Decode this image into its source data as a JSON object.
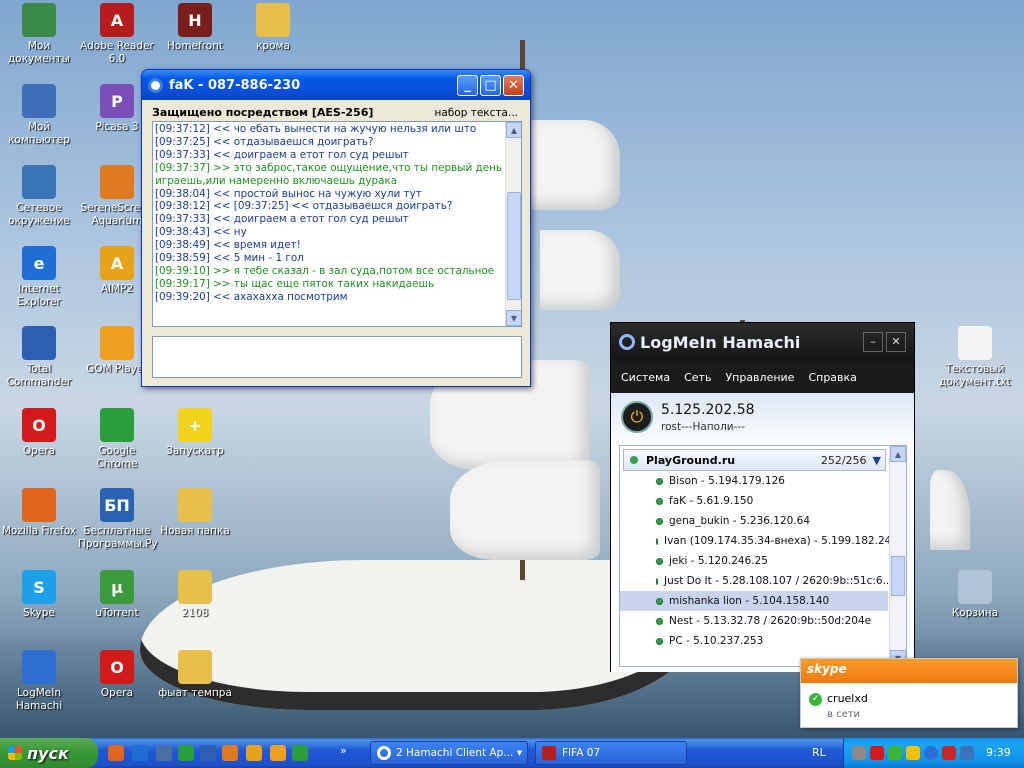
{
  "desktop_icons": [
    {
      "label": "Мои документы",
      "glyph": "",
      "color": "#3b8a4a"
    },
    {
      "label": "Adobe Reader 6.0",
      "glyph": "A",
      "color": "#b71c1c"
    },
    {
      "label": "Homefront",
      "glyph": "H",
      "color": "#7a1d1d"
    },
    {
      "label": "крома",
      "glyph": "",
      "color": "#e6c04a"
    },
    {
      "label": "Мой компьютер",
      "glyph": "",
      "color": "#3d6fb8"
    },
    {
      "label": "Picasa 3",
      "glyph": "P",
      "color": "#7b4fb8"
    },
    {
      "label": "Сетевое окружение",
      "glyph": "",
      "color": "#3a74b6"
    },
    {
      "label": "SereneScreen Aquarium",
      "glyph": "",
      "color": "#e07a1f"
    },
    {
      "label": "Internet Explorer",
      "glyph": "e",
      "color": "#1f6ed4"
    },
    {
      "label": "AIMP2",
      "glyph": "A",
      "color": "#e8a21a"
    },
    {
      "label": "Total Commander",
      "glyph": "",
      "color": "#2d5fb2"
    },
    {
      "label": "GOM Player",
      "glyph": "",
      "color": "#f0a020"
    },
    {
      "label": "Opera",
      "glyph": "O",
      "color": "#d21a1a"
    },
    {
      "label": "Google Chrome",
      "glyph": "",
      "color": "#2a9d3c"
    },
    {
      "label": "Запускатр",
      "glyph": "+",
      "color": "#f2d21a"
    },
    {
      "label": "Mozilla Firefox",
      "glyph": "",
      "color": "#e0661c"
    },
    {
      "label": "Бесплатные Программы.Ру",
      "glyph": "БП",
      "color": "#2962b0"
    },
    {
      "label": "Новая папка",
      "glyph": "",
      "color": "#e6c04a"
    },
    {
      "label": "Skype",
      "glyph": "S",
      "color": "#1ea0e8"
    },
    {
      "label": "uTorrent",
      "glyph": "µ",
      "color": "#3b9a3b"
    },
    {
      "label": "2108",
      "glyph": "",
      "color": "#e6c04a"
    },
    {
      "label": "LogMeIn Hamachi",
      "glyph": "",
      "color": "#2d6fd2"
    },
    {
      "label": "Opera",
      "glyph": "O",
      "color": "#d21a1a"
    },
    {
      "label": "фыат темпра",
      "glyph": "",
      "color": "#e6c04a"
    },
    {
      "label": "Текстовый документ.txt",
      "glyph": "",
      "color": "#f5f5f5"
    },
    {
      "label": "Корзина",
      "glyph": "",
      "color": "#b0c4d8"
    }
  ],
  "chat": {
    "title": "faK - 087-886-230",
    "security_label": "Защищено посредством [AES-256]",
    "typing_label": "набор текста...",
    "input_value": "",
    "lines": [
      {
        "text": "[09:37:12] <<      чо ебать вынести на жучую нельзя или што",
        "style": "gray-blue"
      },
      {
        "text": "[09:37:25] <<      отдазываешся доиграть?",
        "style": "gray-blue"
      },
      {
        "text": "[09:37:33] <<      доиграем а етот гол суд решыт",
        "style": "gray-blue"
      },
      {
        "text": "[09:37:37] >>      это заброс,такое ощущение,что ты первый день",
        "style": "green"
      },
      {
        "text": "играешь,или намеренно включаешь дурака",
        "style": "green"
      },
      {
        "text": "[09:38:04] <<      простой вынос на чужую хули тут",
        "style": "gray-blue"
      },
      {
        "text": "[09:38:12] <<      [09:37:25] <<        отдазываешся доиграть?",
        "style": "gray-blue"
      },
      {
        "text": "[09:37:33] <<      доиграем а етот гол суд решыт",
        "style": "blue"
      },
      {
        "text": "[09:38:43] <<      ну",
        "style": "gray-blue"
      },
      {
        "text": "[09:38:49] <<      время идет!",
        "style": "gray-blue"
      },
      {
        "text": "[09:38:59] <<      5 мин - 1 гол",
        "style": "gray-blue"
      },
      {
        "text": "[09:39:10] >>      я тебе сказал - в зал суда,потом все остальное",
        "style": "green"
      },
      {
        "text": "[09:39:17] >>      ты щас еще пяток таких накидаешь",
        "style": "green"
      },
      {
        "text": "[09:39:20] <<      ахахахха посмотрим",
        "style": "gray-blue"
      }
    ]
  },
  "hamachi": {
    "title": "LogMeIn Hamachi",
    "menu": [
      "Система",
      "Сеть",
      "Управление",
      "Справка"
    ],
    "ip": "5.125.202.58",
    "nick": "rost---Наполи---",
    "network_name": "PlayGround.ru",
    "network_count": "252/256",
    "peers": [
      {
        "label": "Bison - 5.194.179.126",
        "selected": false
      },
      {
        "label": "faK - 5.61.9.150",
        "selected": false
      },
      {
        "label": "gena_bukin - 5.236.120.64",
        "selected": false
      },
      {
        "label": "Ivan (109.174.35.34-внеха) - 5.199.182.24",
        "selected": false
      },
      {
        "label": "jeki - 5.120.246.25",
        "selected": false
      },
      {
        "label": "Just Do It - 5.28.108.107 / 2620:9b::51c:6...",
        "selected": false
      },
      {
        "label": "mishanka lion - 5.104.158.140",
        "selected": true
      },
      {
        "label": "Nest - 5.13.32.78 / 2620:9b::50d:204e",
        "selected": false
      },
      {
        "label": "PC - 5.10.237.253",
        "selected": false
      }
    ]
  },
  "skype_popup": {
    "brand": "skype",
    "user": "cruelxd",
    "status": "в сети"
  },
  "taskbar": {
    "start_label": "пуск",
    "tasks": [
      "2 Hamachi Client Ap...",
      "FIFA 07"
    ],
    "lang": "RL",
    "clock": "9:39"
  },
  "colors": {
    "xp_blue": "#0058e6",
    "hamachi_dark": "#1b1b1b",
    "skype_orange": "#f07a10",
    "chat_green": "#209020"
  }
}
